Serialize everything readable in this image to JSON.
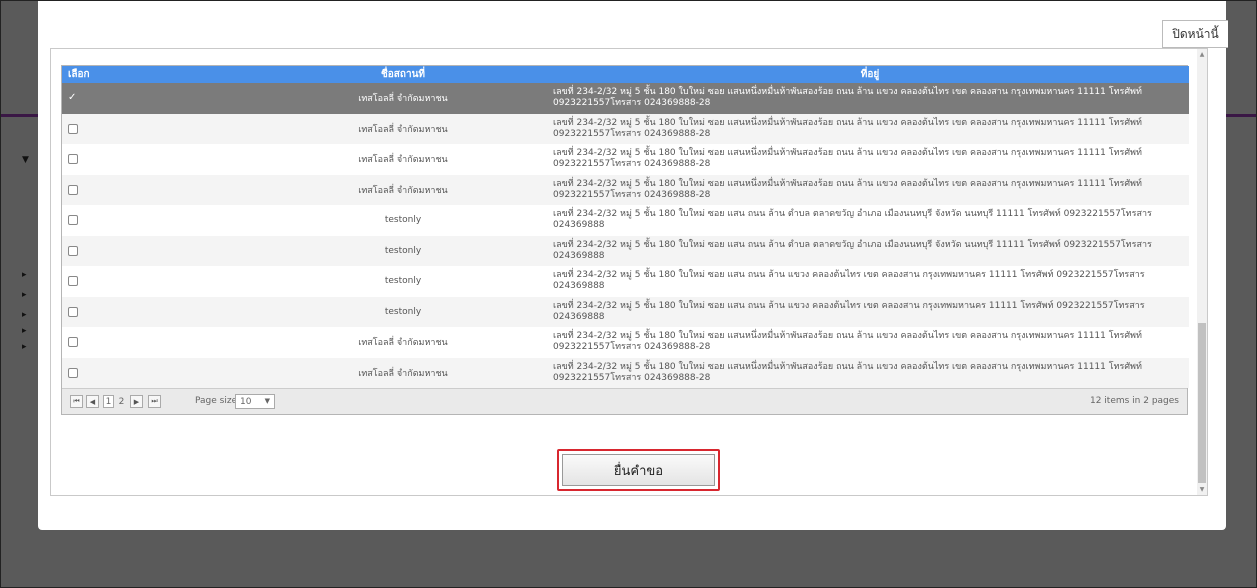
{
  "modal": {
    "close_label": "ปิดหน้านี้",
    "submit_label": "ยื่นคำขอ"
  },
  "grid": {
    "columns": [
      "เลือก",
      "ชื่อสถานที่",
      "ที่อยู่"
    ],
    "rows": [
      {
        "selected": true,
        "name": "เทสโอลลี่ จำกัดมหาชน",
        "addr": "เลขที่ 234-2/32 หมู่ 5 ชั้น 180 ใบใหม่ ซอย แสนหนึ่งหมื่นห้าพันสองร้อย ถนน ล้าน แขวง คลองต้นไทร เขต คลองสาน กรุงเทพมหานคร 11111 โทรศัพท์ 0923221557โทรสาร 024369888-28"
      },
      {
        "selected": false,
        "name": "เทสโอลลี่ จำกัดมหาชน",
        "addr": "เลขที่ 234-2/32 หมู่ 5 ชั้น 180 ใบใหม่ ซอย แสนหนึ่งหมื่นห้าพันสองร้อย ถนน ล้าน แขวง คลองต้นไทร เขต คลองสาน กรุงเทพมหานคร 11111 โทรศัพท์ 0923221557โทรสาร 024369888-28"
      },
      {
        "selected": false,
        "name": "เทสโอลลี่ จำกัดมหาชน",
        "addr": "เลขที่ 234-2/32 หมู่ 5 ชั้น 180 ใบใหม่ ซอย แสนหนึ่งหมื่นห้าพันสองร้อย ถนน ล้าน แขวง คลองต้นไทร เขต คลองสาน กรุงเทพมหานคร 11111 โทรศัพท์ 0923221557โทรสาร 024369888-28"
      },
      {
        "selected": false,
        "name": "เทสโอลลี่ จำกัดมหาชน",
        "addr": "เลขที่ 234-2/32 หมู่ 5 ชั้น 180 ใบใหม่ ซอย แสนหนึ่งหมื่นห้าพันสองร้อย ถนน ล้าน แขวง คลองต้นไทร เขต คลองสาน กรุงเทพมหานคร 11111 โทรศัพท์ 0923221557โทรสาร 024369888-28"
      },
      {
        "selected": false,
        "name": "testonly",
        "addr": "เลขที่ 234-2/32 หมู่ 5 ชั้น 180 ใบใหม่ ซอย แสน ถนน ล้าน ตำบล ตลาดขวัญ อำเภอ เมืองนนทบุรี จังหวัด นนทบุรี 11111 โทรศัพท์ 0923221557โทรสาร 024369888"
      },
      {
        "selected": false,
        "name": "testonly",
        "addr": "เลขที่ 234-2/32 หมู่ 5 ชั้น 180 ใบใหม่ ซอย แสน ถนน ล้าน ตำบล ตลาดขวัญ อำเภอ เมืองนนทบุรี จังหวัด นนทบุรี 11111 โทรศัพท์ 0923221557โทรสาร 024369888"
      },
      {
        "selected": false,
        "name": "testonly",
        "addr": "เลขที่ 234-2/32 หมู่ 5 ชั้น 180 ใบใหม่ ซอย แสน ถนน ล้าน แขวง คลองต้นไทร เขต คลองสาน กรุงเทพมหานคร 11111 โทรศัพท์ 0923221557โทรสาร 024369888"
      },
      {
        "selected": false,
        "name": "testonly",
        "addr": "เลขที่ 234-2/32 หมู่ 5 ชั้น 180 ใบใหม่ ซอย แสน ถนน ล้าน แขวง คลองต้นไทร เขต คลองสาน กรุงเทพมหานคร 11111 โทรศัพท์ 0923221557โทรสาร 024369888"
      },
      {
        "selected": false,
        "name": "เทสโอลลี่ จำกัดมหาชน",
        "addr": "เลขที่ 234-2/32 หมู่ 5 ชั้น 180 ใบใหม่ ซอย แสนหนึ่งหมื่นห้าพันสองร้อย ถนน ล้าน แขวง คลองต้นไทร เขต คลองสาน กรุงเทพมหานคร 11111 โทรศัพท์ 0923221557โทรสาร 024369888-28"
      },
      {
        "selected": false,
        "name": "เทสโอลลี่ จำกัดมหาชน",
        "addr": "เลขที่ 234-2/32 หมู่ 5 ชั้น 180 ใบใหม่ ซอย แสนหนึ่งหมื่นห้าพันสองร้อย ถนน ล้าน แขวง คลองต้นไทร เขต คลองสาน กรุงเทพมหานคร 11111 โทรศัพท์ 0923221557โทรสาร 024369888-28"
      }
    ],
    "check_mark": "✓"
  },
  "pager": {
    "first_icon": "first-page-icon",
    "prev_icon": "prev-page-icon",
    "next_icon": "next-page-icon",
    "last_icon": "last-page-icon",
    "pages": [
      "1",
      "2"
    ],
    "current_page": "1",
    "page_size_label": "Page size:",
    "page_size_value": "10",
    "summary": "12 items in 2 pages"
  },
  "colors": {
    "header_blue": "#4a90e8",
    "selected_row": "#7b7b7b",
    "submit_outline": "#d8272f"
  }
}
